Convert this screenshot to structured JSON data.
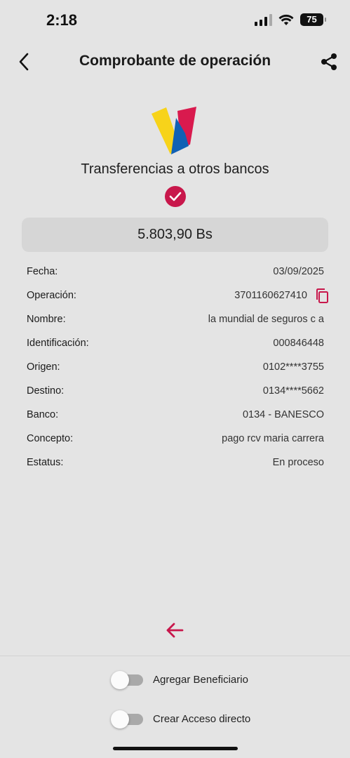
{
  "status_bar": {
    "time": "2:18",
    "battery": "75"
  },
  "header": {
    "title": "Comprobante de operación"
  },
  "operation": {
    "type": "Transferencias a otros bancos",
    "amount": "5.803,90 Bs"
  },
  "details": [
    {
      "label": "Fecha:",
      "value": "03/09/2025"
    },
    {
      "label": "Operación:",
      "value": "3701160627410"
    },
    {
      "label": "Nombre:",
      "value": "la mundial de seguros c a"
    },
    {
      "label": "Identificación:",
      "value": "000846448"
    },
    {
      "label": "Origen:",
      "value": "0102****3755"
    },
    {
      "label": "Destino:",
      "value": "0134****5662"
    },
    {
      "label": "Banco:",
      "value": "0134 - BANESCO"
    },
    {
      "label": "Concepto:",
      "value": "pago rcv maria carrera"
    },
    {
      "label": "Estatus:",
      "value": "En proceso"
    }
  ],
  "toggles": [
    {
      "label": "Agregar Beneficiario",
      "on": false
    },
    {
      "label": "Crear Acceso directo",
      "on": false
    }
  ],
  "colors": {
    "accent": "#c8174b",
    "background": "#e4e4e4",
    "amount_box": "#d6d6d6"
  }
}
